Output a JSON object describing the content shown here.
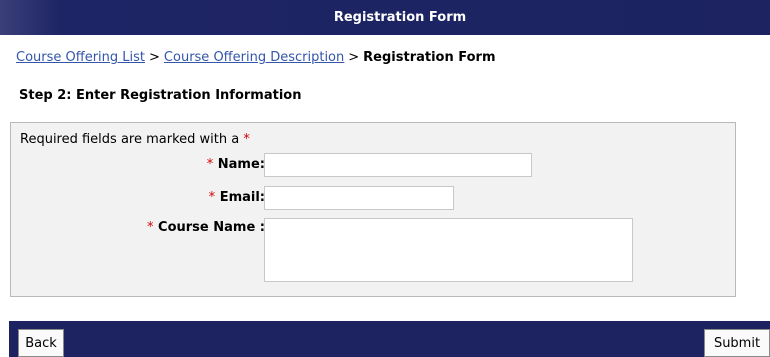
{
  "header": {
    "title": "Registration Form"
  },
  "breadcrumb": {
    "items": [
      {
        "label": "Course Offering List"
      },
      {
        "label": "Course Offering Description"
      }
    ],
    "separator": ">",
    "current": "Registration Form"
  },
  "step": {
    "heading": "Step 2: Enter Registration Information"
  },
  "form": {
    "required_note": "Required fields are marked with a",
    "required_marker": "*",
    "fields": [
      {
        "label": "Name:",
        "value": "",
        "placeholder": ""
      },
      {
        "label": "Email:",
        "value": "",
        "placeholder": ""
      },
      {
        "label": "Course Name :",
        "value": "",
        "placeholder": ""
      }
    ]
  },
  "footer": {
    "back_label": "Back",
    "submit_label": "Submit"
  },
  "colors": {
    "header_bg": "#1c2360",
    "link": "#3355aa",
    "required": "#d40000",
    "panel_bg": "#f2f2f2"
  }
}
